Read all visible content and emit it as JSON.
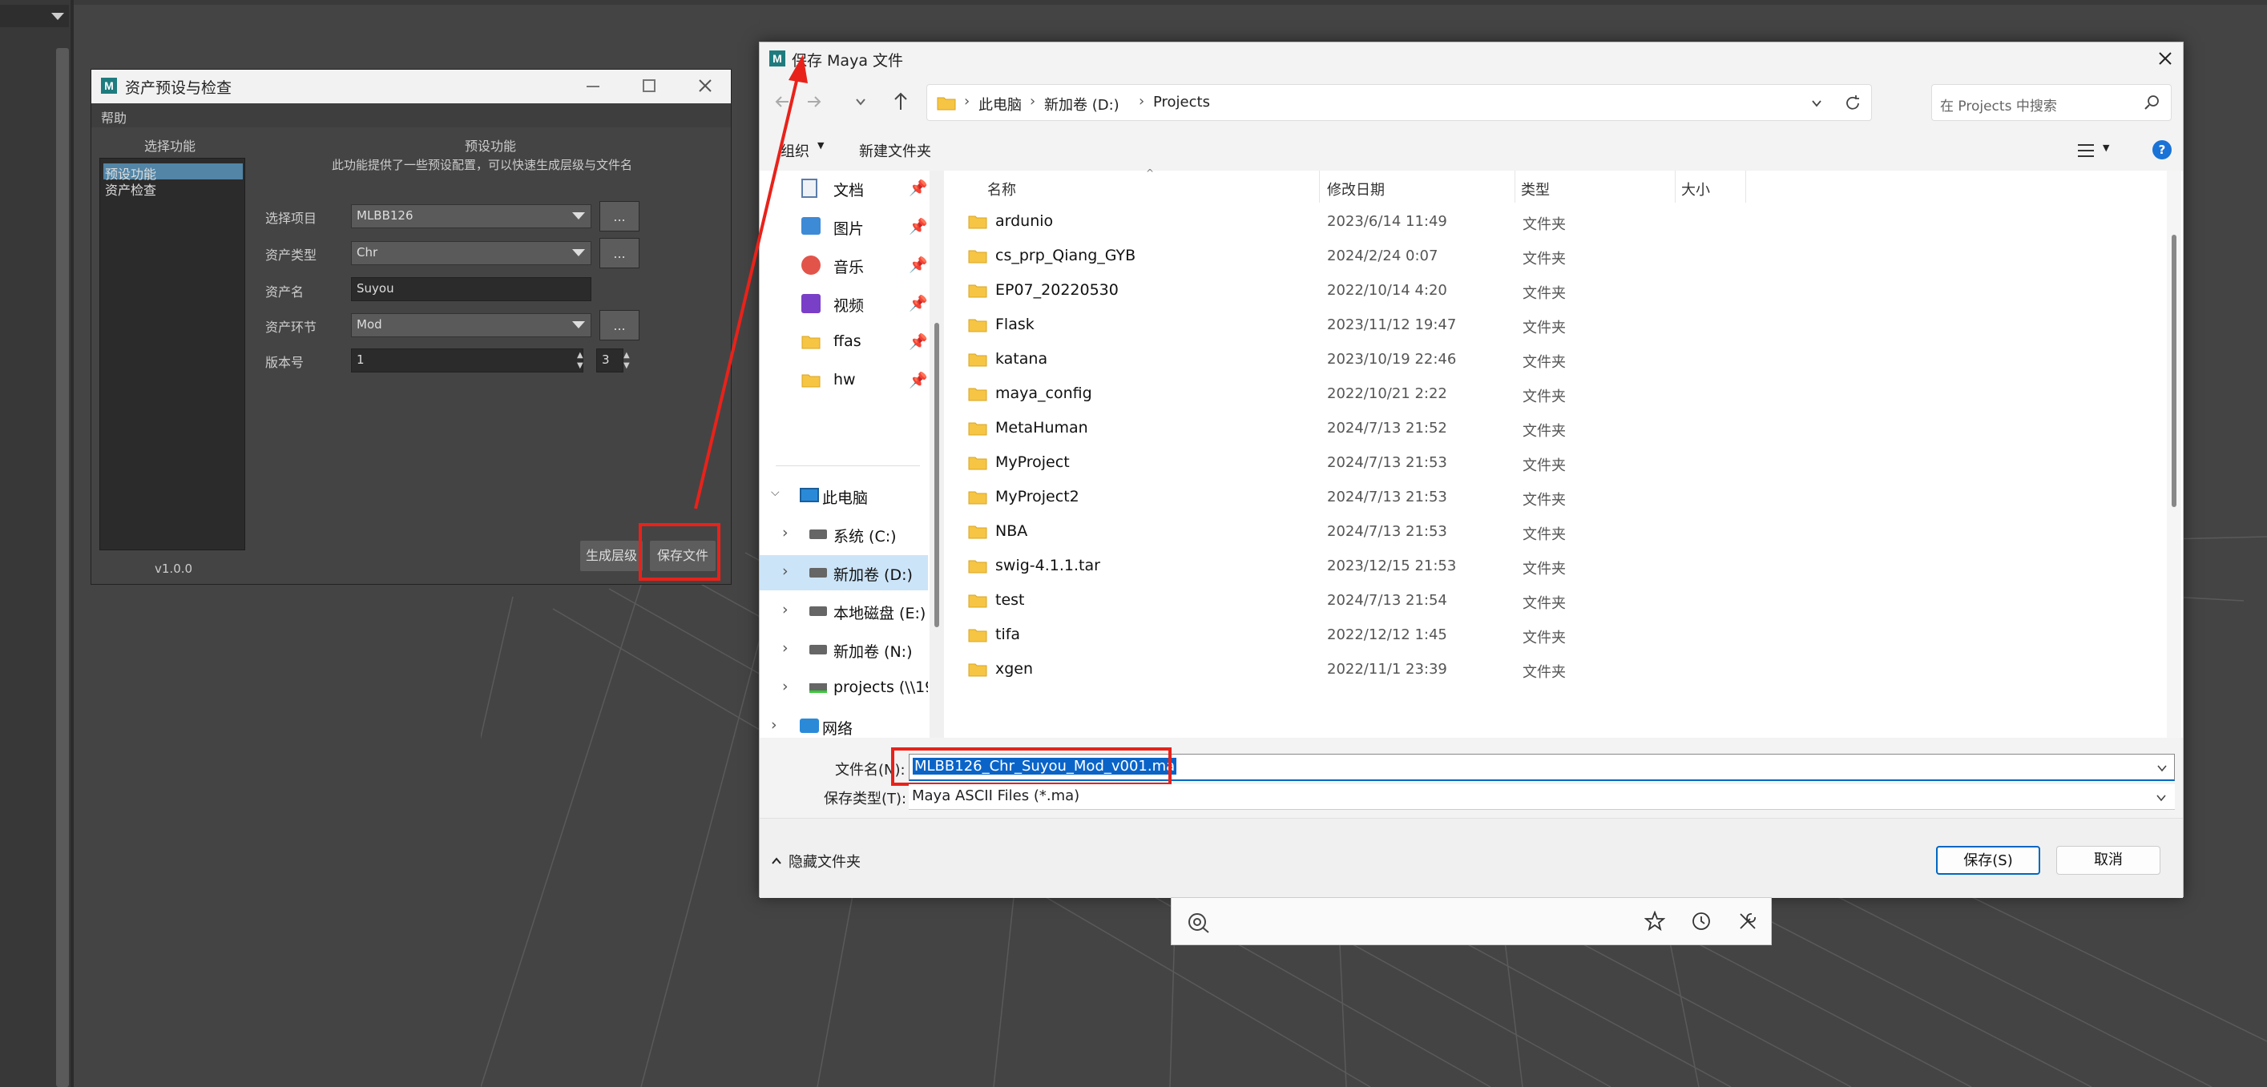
{
  "preset_window": {
    "title": "资产预设与检查",
    "menu_help": "帮助",
    "left_header": "选择功能",
    "list_items": [
      "预设功能",
      "资产检查"
    ],
    "version": "v1.0.0",
    "right_header": "预设功能",
    "description": "此功能提供了一些预设配置，可以快速生成层级与文件名",
    "fields": {
      "project_label": "选择项目",
      "project_value": "MLBB126",
      "type_label": "资产类型",
      "type_value": "Chr",
      "name_label": "资产名",
      "name_value": "Suyou",
      "stage_label": "资产环节",
      "stage_value": "Mod",
      "version_label": "版本号",
      "version_value": "1",
      "version_digits": "3"
    },
    "dots": "...",
    "gen_button": "生成层级",
    "save_button": "保存文件"
  },
  "dialog": {
    "title": "保存 Maya 文件",
    "breadcrumb": [
      "此电脑",
      "新加卷 (D:)",
      "Projects"
    ],
    "search_placeholder": "在 Projects 中搜索",
    "organize": "组织",
    "new_folder": "新建文件夹",
    "nav": {
      "quick": [
        "文档",
        "图片",
        "音乐",
        "视频",
        "ffas",
        "hw"
      ],
      "pc": "此电脑",
      "drives": [
        "系统 (C:)",
        "新加卷 (D:)",
        "本地磁盘 (E:)",
        "新加卷 (N:)",
        "projects (\\\\19"
      ],
      "network": "网络"
    },
    "columns": {
      "name": "名称",
      "date": "修改日期",
      "type": "类型",
      "size": "大小"
    },
    "files": [
      {
        "name": "ardunio",
        "date": "2023/6/14 11:49",
        "type": "文件夹"
      },
      {
        "name": "cs_prp_Qiang_GYB",
        "date": "2024/2/24 0:07",
        "type": "文件夹"
      },
      {
        "name": "EP07_20220530",
        "date": "2022/10/14 4:20",
        "type": "文件夹"
      },
      {
        "name": "Flask",
        "date": "2023/11/12 19:47",
        "type": "文件夹"
      },
      {
        "name": "katana",
        "date": "2023/10/19 22:46",
        "type": "文件夹"
      },
      {
        "name": "maya_config",
        "date": "2022/10/21 2:22",
        "type": "文件夹"
      },
      {
        "name": "MetaHuman",
        "date": "2024/7/13 21:52",
        "type": "文件夹"
      },
      {
        "name": "MyProject",
        "date": "2024/7/13 21:53",
        "type": "文件夹"
      },
      {
        "name": "MyProject2",
        "date": "2024/7/13 21:53",
        "type": "文件夹"
      },
      {
        "name": "NBA",
        "date": "2024/7/13 21:53",
        "type": "文件夹"
      },
      {
        "name": "swig-4.1.1.tar",
        "date": "2023/12/15 21:53",
        "type": "文件夹"
      },
      {
        "name": "test",
        "date": "2024/7/13 21:54",
        "type": "文件夹"
      },
      {
        "name": "tifa",
        "date": "2022/12/12 1:45",
        "type": "文件夹"
      },
      {
        "name": "xgen",
        "date": "2022/11/1 23:39",
        "type": "文件夹"
      }
    ],
    "filename_label": "文件名(N):",
    "filename_value": "MLBB126_Chr_Suyou_Mod_v001.ma",
    "filetype_label": "保存类型(T):",
    "filetype_value": "Maya ASCII Files (*.ma)",
    "hide_folders": "隐藏文件夹",
    "save": "保存(S)",
    "cancel": "取消"
  },
  "colors": {
    "accent": "#1e7c7e",
    "highlight": "#e8221a",
    "selection": "#0a64c8"
  }
}
